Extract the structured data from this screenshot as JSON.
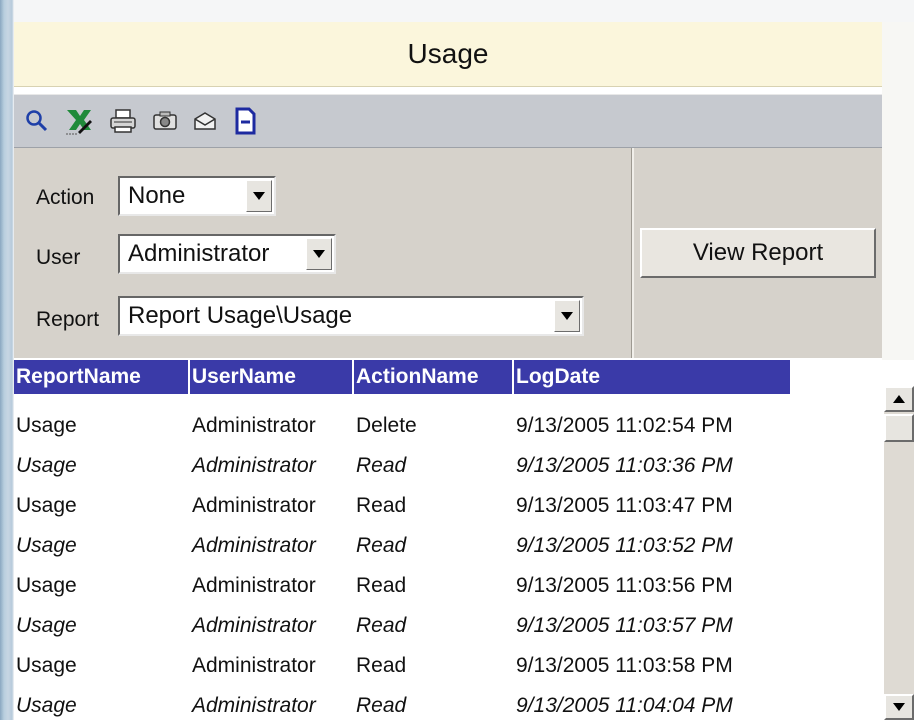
{
  "header": {
    "title": "Usage"
  },
  "toolbar": {
    "icons": [
      "search-icon",
      "export-excel-icon",
      "print-icon",
      "camera-icon",
      "email-icon",
      "document-icon"
    ]
  },
  "params": {
    "action_label": "Action",
    "action_value": "None",
    "user_label": "User",
    "user_value": "Administrator",
    "report_label": "Report",
    "report_value": "Report Usage\\Usage",
    "view_report_label": "View Report"
  },
  "grid": {
    "columns": [
      "ReportName",
      "UserName",
      "ActionName",
      "LogDate"
    ],
    "rows": [
      [
        "Usage",
        "Administrator",
        "Delete",
        "9/13/2005 11:02:54 PM"
      ],
      [
        "Usage",
        "Administrator",
        "Read",
        "9/13/2005 11:03:36 PM"
      ],
      [
        "Usage",
        "Administrator",
        "Read",
        "9/13/2005 11:03:47 PM"
      ],
      [
        "Usage",
        "Administrator",
        "Read",
        "9/13/2005 11:03:52 PM"
      ],
      [
        "Usage",
        "Administrator",
        "Read",
        "9/13/2005 11:03:56 PM"
      ],
      [
        "Usage",
        "Administrator",
        "Read",
        "9/13/2005 11:03:57 PM"
      ],
      [
        "Usage",
        "Administrator",
        "Read",
        "9/13/2005 11:03:58 PM"
      ],
      [
        "Usage",
        "Administrator",
        "Read",
        "9/13/2005 11:04:04 PM"
      ]
    ]
  },
  "colors": {
    "header_bg": "#3a3aa8",
    "title_bg": "#fbf6dc",
    "toolbar_bg": "#c6c9cf",
    "params_bg": "#d6d2cb"
  }
}
